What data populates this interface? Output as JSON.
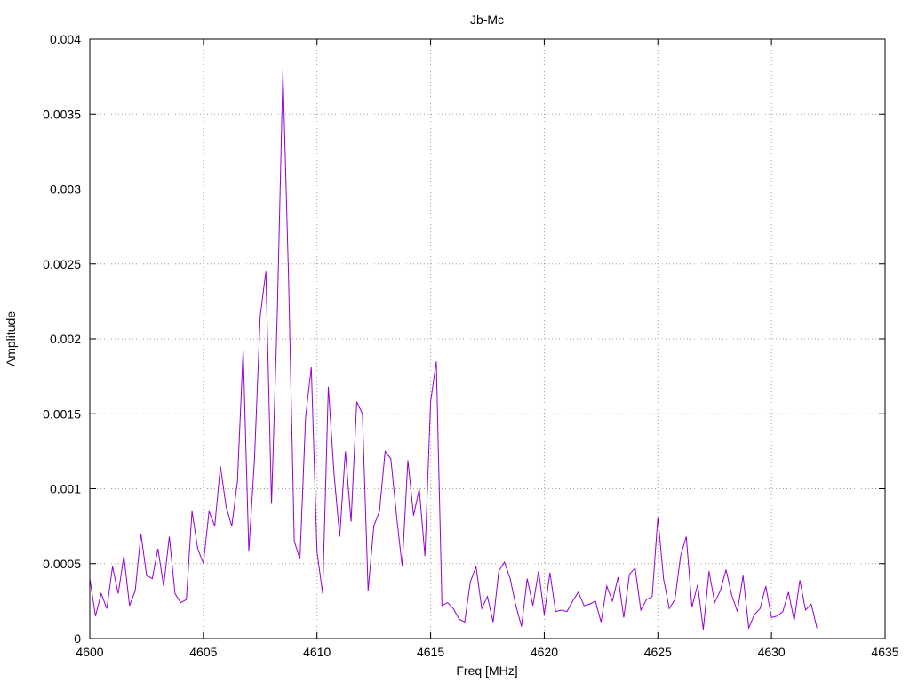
{
  "chart_data": {
    "type": "line",
    "title": "Jb-Mc",
    "xlabel": "Freq [MHz]",
    "ylabel": "Amplitude",
    "xlim": [
      4600,
      4635
    ],
    "ylim": [
      0,
      0.004
    ],
    "x_ticks": [
      4600,
      4605,
      4610,
      4615,
      4620,
      4625,
      4630,
      4635
    ],
    "y_ticks": [
      0,
      0.0005,
      0.001,
      0.0015,
      0.002,
      0.0025,
      0.003,
      0.0035,
      0.004
    ],
    "x_tick_labels": [
      "4600",
      "4605",
      "4610",
      "4615",
      "4620",
      "4625",
      "4630",
      "4635"
    ],
    "y_tick_labels": [
      "0",
      "0.0005",
      "0.001",
      "0.0015",
      "0.002",
      "0.0025",
      "0.003",
      "0.0035",
      "0.004"
    ],
    "grid": true,
    "legend": "none",
    "series": [
      {
        "color": "#9400d3",
        "x": [
          4600.0,
          4600.25,
          4600.5,
          4600.75,
          4601.0,
          4601.25,
          4601.5,
          4601.75,
          4602.0,
          4602.25,
          4602.5,
          4602.75,
          4603.0,
          4603.25,
          4603.5,
          4603.75,
          4604.0,
          4604.25,
          4604.5,
          4604.75,
          4605.0,
          4605.25,
          4605.5,
          4605.75,
          4606.0,
          4606.25,
          4606.5,
          4606.75,
          4607.0,
          4607.25,
          4607.5,
          4607.75,
          4608.0,
          4608.25,
          4608.5,
          4608.75,
          4609.0,
          4609.25,
          4609.5,
          4609.75,
          4610.0,
          4610.25,
          4610.5,
          4610.75,
          4611.0,
          4611.25,
          4611.5,
          4611.75,
          4612.0,
          4612.25,
          4612.5,
          4612.75,
          4613.0,
          4613.25,
          4613.5,
          4613.75,
          4614.0,
          4614.25,
          4614.5,
          4614.75,
          4615.0,
          4615.25,
          4615.5,
          4615.75,
          4616.0,
          4616.25,
          4616.5,
          4616.75,
          4617.0,
          4617.25,
          4617.5,
          4617.75,
          4618.0,
          4618.25,
          4618.5,
          4618.75,
          4619.0,
          4619.25,
          4619.5,
          4619.75,
          4620.0,
          4620.25,
          4620.5,
          4620.75,
          4621.0,
          4621.25,
          4621.5,
          4621.75,
          4622.0,
          4622.25,
          4622.5,
          4622.75,
          4623.0,
          4623.25,
          4623.5,
          4623.75,
          4624.0,
          4624.25,
          4624.5,
          4624.75,
          4625.0,
          4625.25,
          4625.5,
          4625.75,
          4626.0,
          4626.25,
          4626.5,
          4626.75,
          4627.0,
          4627.25,
          4627.5,
          4627.75,
          4628.0,
          4628.25,
          4628.5,
          4628.75,
          4629.0,
          4629.25,
          4629.5,
          4629.75,
          4630.0,
          4630.25,
          4630.5,
          4630.75,
          4631.0,
          4631.25,
          4631.5,
          4631.75,
          4632.0
        ],
        "values": [
          0.0004,
          0.00015,
          0.0003,
          0.0002,
          0.00048,
          0.0003,
          0.00055,
          0.00022,
          0.00032,
          0.0007,
          0.00042,
          0.0004,
          0.0006,
          0.00035,
          0.00068,
          0.0003,
          0.00024,
          0.00026,
          0.00085,
          0.0006,
          0.0005,
          0.00085,
          0.00075,
          0.00115,
          0.00088,
          0.00075,
          0.00105,
          0.00193,
          0.00058,
          0.0012,
          0.00215,
          0.00245,
          0.0009,
          0.00215,
          0.00379,
          0.0024,
          0.00065,
          0.00053,
          0.00148,
          0.00181,
          0.00058,
          0.0003,
          0.00168,
          0.0011,
          0.00068,
          0.00125,
          0.00078,
          0.00158,
          0.0015,
          0.00032,
          0.00075,
          0.00085,
          0.00125,
          0.0012,
          0.00082,
          0.00048,
          0.00119,
          0.00082,
          0.001,
          0.00055,
          0.00158,
          0.00185,
          0.00022,
          0.00024,
          0.0002,
          0.00013,
          0.00011,
          0.00038,
          0.00048,
          0.0002,
          0.00028,
          0.00011,
          0.00045,
          0.00051,
          0.0004,
          0.00022,
          8e-05,
          0.0004,
          0.00022,
          0.00045,
          0.00016,
          0.00044,
          0.00018,
          0.00019,
          0.00018,
          0.00025,
          0.00031,
          0.00022,
          0.00023,
          0.00025,
          0.00011,
          0.00035,
          0.00025,
          0.00041,
          0.00014,
          0.00043,
          0.00047,
          0.00019,
          0.00026,
          0.00028,
          0.00081,
          0.0004,
          0.0002,
          0.00026,
          0.00055,
          0.00068,
          0.00021,
          0.00036,
          6e-05,
          0.00045,
          0.00024,
          0.00032,
          0.00046,
          0.00029,
          0.00018,
          0.00042,
          7e-05,
          0.00016,
          0.0002,
          0.00035,
          0.00014,
          0.00015,
          0.00018,
          0.00031,
          0.00012,
          0.00039,
          0.00019,
          0.00023,
          7e-05
        ]
      }
    ]
  }
}
